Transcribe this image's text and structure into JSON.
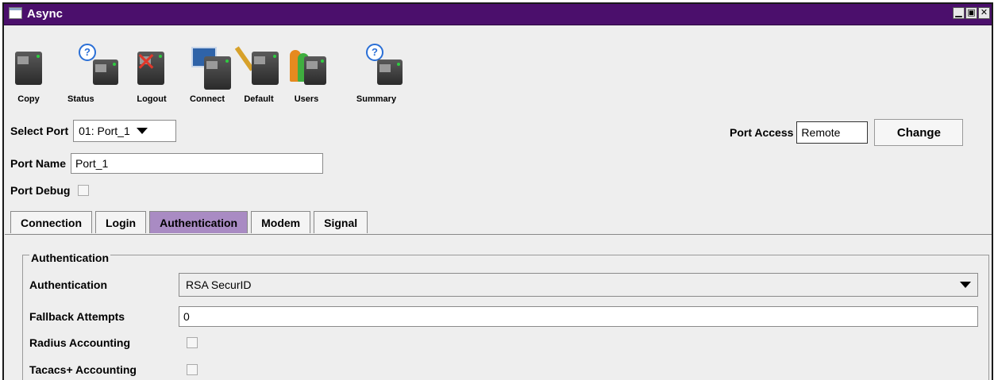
{
  "window": {
    "title": "Async",
    "controls": [
      "minimize",
      "maximize",
      "close"
    ]
  },
  "toolbar": [
    {
      "label": "Copy",
      "icon": "copy-port-icon"
    },
    {
      "label": "Status",
      "icon": "status-port-icon"
    },
    {
      "label": "Logout",
      "icon": "logout-port-icon"
    },
    {
      "label": "Connect",
      "icon": "connect-port-icon"
    },
    {
      "label": "Default",
      "icon": "default-port-icon"
    },
    {
      "label": "Users",
      "icon": "users-port-icon"
    },
    {
      "label": "Summary",
      "icon": "summary-port-icon"
    }
  ],
  "port": {
    "select_label": "Select Port",
    "select_value": "01: Port_1",
    "access_label": "Port Access",
    "access_value": "Remote",
    "change_label": "Change",
    "name_label": "Port Name",
    "name_value": "Port_1",
    "debug_label": "Port Debug"
  },
  "tabs": [
    {
      "label": "Connection",
      "active": false
    },
    {
      "label": "Login",
      "active": false
    },
    {
      "label": "Authentication",
      "active": true
    },
    {
      "label": "Modem",
      "active": false
    },
    {
      "label": "Signal",
      "active": false
    }
  ],
  "auth": {
    "group_title": "Authentication",
    "authentication_label": "Authentication",
    "authentication_value": "RSA SecurID",
    "fallback_label": "Fallback Attempts",
    "fallback_value": "0",
    "radius_label": "Radius Accounting",
    "tacacs_label": "Tacacs+ Accounting"
  },
  "colors": {
    "titlebar": "#4b0f6c",
    "active_tab": "#a98bc3"
  }
}
